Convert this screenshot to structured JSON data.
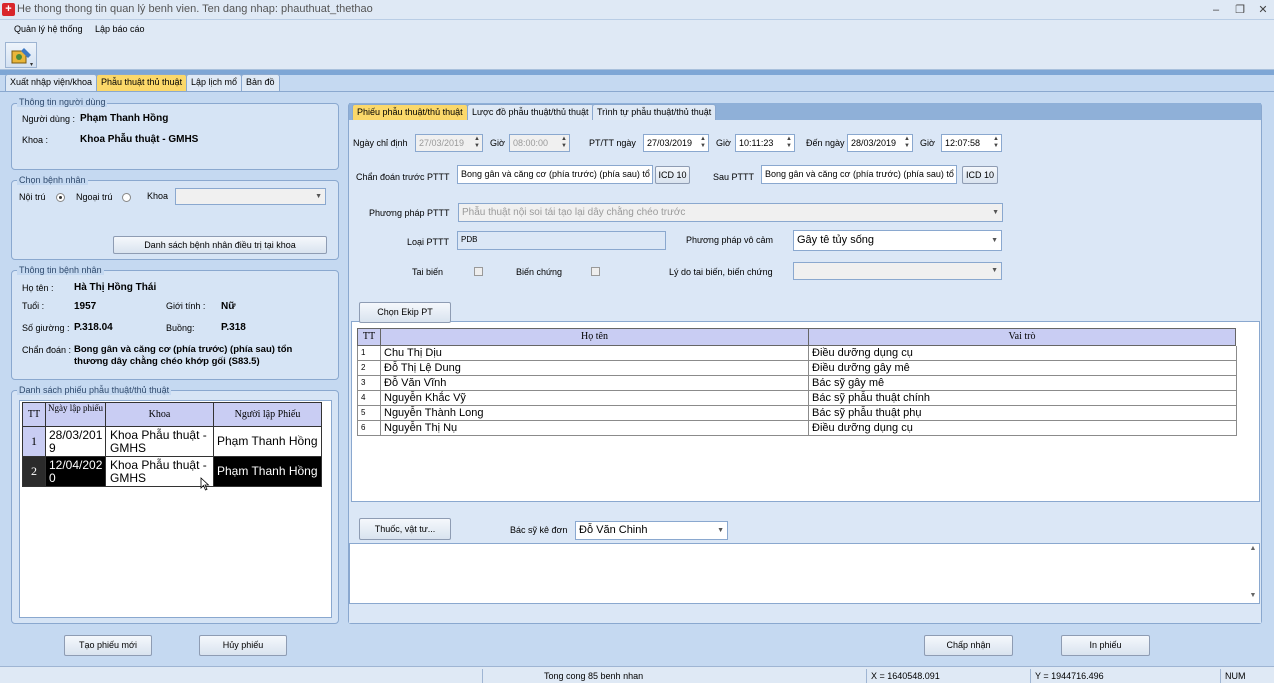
{
  "window": {
    "title": "He thong thong tin quan lý benh vien. Ten dang nhap: phauthuat_thethao",
    "minimize": "–",
    "restore": "❐",
    "close": "✕"
  },
  "menu": [
    "Quản lý hệ thống",
    "Lập báo cáo"
  ],
  "main_tabs": [
    "Xuất nhập viện/khoa",
    "Phẫu thuật thủ thuật",
    "Lập lịch mổ",
    "Bản đồ"
  ],
  "user_info": {
    "group_label": "Thông tin người dùng",
    "user_label": "Người dùng :",
    "user_value": "Phạm Thanh Hồng",
    "dept_label": "Khoa :",
    "dept_value": "Khoa Phẫu thuật - GMHS"
  },
  "patient_select": {
    "group_label": "Chọn bệnh nhân",
    "inpatient": "Nội trú",
    "outpatient": "Ngoại trú",
    "dept_label": "Khoa",
    "list_button": "Danh sách bệnh nhân điều trị tại khoa"
  },
  "patient_info": {
    "group_label": "Thông tin bệnh nhân",
    "name_label": "Họ tên :",
    "name_value": "Hà Thị Hồng Thái",
    "age_label": "Tuổi :",
    "age_value": "1957",
    "gender_label": "Giới tính :",
    "gender_value": "Nữ",
    "bed_label": "Số giường :",
    "bed_value": "P.318.04",
    "room_label": "Buồng:",
    "room_value": "P.318",
    "diag_label": "Chẩn đoán :",
    "diag_line1": "Bong gân và căng cơ (phía trước) (phía sau) tổn",
    "diag_line2": "thương dây chằng chéo khớp gối (S83.5)"
  },
  "form_list": {
    "group_label": "Danh sách phiếu phẫu thuật/thủ thuật",
    "headers": [
      "TT",
      "Ngày lập phiếu",
      "Khoa",
      "Người lập Phiếu"
    ],
    "rows": [
      {
        "tt": "1",
        "date_l1": "28/03/201",
        "date_l2": "9",
        "dept_l1": "Khoa Phẫu thuật -",
        "dept_l2": "GMHS",
        "creator": "Phạm Thanh Hồng"
      },
      {
        "tt": "2",
        "date_l1": "12/04/202",
        "date_l2": "0",
        "dept_l1": "Khoa Phẫu thuật -",
        "dept_l2": "GMHS",
        "creator": "Phạm Thanh Hồng"
      }
    ]
  },
  "sub_tabs": [
    "Phiếu phẫu thuật/thủ thuật",
    "Lược đồ phẫu thuật/thủ thuật",
    "Trình tự phẫu thuật/thủ thuật"
  ],
  "form": {
    "assign_date_label": "Ngày chỉ định",
    "assign_date": "27/03/2019",
    "time_label": "Giờ",
    "assign_time": "08:00:00",
    "pt_date_label": "PT/TT ngày",
    "pt_date": "27/03/2019",
    "pt_time": "10:11:23",
    "to_date_label": "Đến ngày",
    "to_date": "28/03/2019",
    "to_time": "12:07:58",
    "pre_diag_label": "Chẩn đoán trước PTTT",
    "pre_diag": "Bong gân và căng cơ (phía trước) (phía sau) tổ",
    "icd_label": "ICD 10",
    "post_label": "Sau PTTT",
    "post_diag": "Bong gân và căng cơ (phía trước) (phía sau) tổ",
    "method_label": "Phương pháp PTTT",
    "method_value": "Phẫu thuật nội soi tái tạo lại dây chằng chéo trước",
    "type_label": "Loại PTTT",
    "type_value": "PDB",
    "anesth_label": "Phương pháp vô cảm",
    "anesth_value": "Gây tê tủy sống",
    "accident_label": "Tai biến",
    "complication_label": "Biến chứng",
    "reason_label": "Lý do tai biến, biến chứng"
  },
  "ekip": {
    "button": "Chọn Ekip PT",
    "headers": [
      "TT",
      "Họ tên",
      "Vai trò"
    ],
    "rows": [
      {
        "tt": "1",
        "name": "Chu Thị Dịu",
        "role": "Điều dưỡng dụng cụ"
      },
      {
        "tt": "2",
        "name": "Đỗ Thị Lệ Dung",
        "role": "Điều dưỡng gây mê"
      },
      {
        "tt": "3",
        "name": "Đỗ Văn Vĩnh",
        "role": "Bác sỹ gây mê"
      },
      {
        "tt": "4",
        "name": "Nguyễn Khắc Vỹ",
        "role": "Bác sỹ phẫu thuật chính"
      },
      {
        "tt": "5",
        "name": "Nguyễn Thành Long",
        "role": "Bác sỹ phẫu thuật phụ"
      },
      {
        "tt": "6",
        "name": "Nguyễn Thị Nụ",
        "role": "Điều dưỡng dụng cụ"
      }
    ]
  },
  "meds": {
    "button": "Thuốc, vật tư...",
    "doctor_label": "Bác sỹ kê đơn",
    "doctor_value": "Đỗ Văn Chinh"
  },
  "bottom_buttons": {
    "new_form": "Tạo phiếu mới",
    "cancel_form": "Hủy phiếu",
    "accept": "Chấp nhận",
    "print": "In phiếu"
  },
  "status": {
    "total": "Tong cong 85 benh nhan",
    "x": "X = 1640548.091",
    "y": "Y = 1944716.496",
    "num": "NUM"
  },
  "colors": {
    "active_tab": "#fbd86a",
    "selected_row": "#000000",
    "header_bg": "#c9cdf3"
  }
}
